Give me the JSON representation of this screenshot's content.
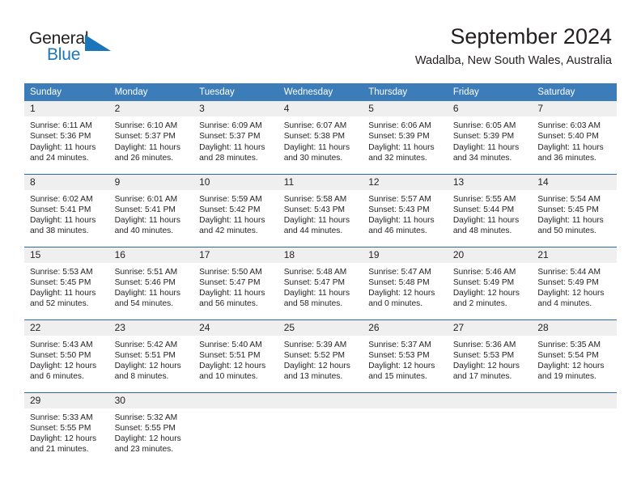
{
  "logo": {
    "word_one": "General",
    "word_two": "Blue",
    "triangle_icon": "triangle-icon"
  },
  "header": {
    "title": "September 2024",
    "subtitle": "Wadalba, New South Wales, Australia"
  },
  "colors": {
    "header_blue": "#3b7cb9",
    "row_divider_blue": "#2b6aa8",
    "daynum_band": "#efefef",
    "logo_blue": "#1b75bb",
    "text": "#231f20"
  },
  "calendar": {
    "weekday_headers": [
      "Sunday",
      "Monday",
      "Tuesday",
      "Wednesday",
      "Thursday",
      "Friday",
      "Saturday"
    ],
    "weeks": [
      [
        {
          "day": "1",
          "sunrise": "Sunrise: 6:11 AM",
          "sunset": "Sunset: 5:36 PM",
          "daylight": "Daylight: 11 hours and 24 minutes."
        },
        {
          "day": "2",
          "sunrise": "Sunrise: 6:10 AM",
          "sunset": "Sunset: 5:37 PM",
          "daylight": "Daylight: 11 hours and 26 minutes."
        },
        {
          "day": "3",
          "sunrise": "Sunrise: 6:09 AM",
          "sunset": "Sunset: 5:37 PM",
          "daylight": "Daylight: 11 hours and 28 minutes."
        },
        {
          "day": "4",
          "sunrise": "Sunrise: 6:07 AM",
          "sunset": "Sunset: 5:38 PM",
          "daylight": "Daylight: 11 hours and 30 minutes."
        },
        {
          "day": "5",
          "sunrise": "Sunrise: 6:06 AM",
          "sunset": "Sunset: 5:39 PM",
          "daylight": "Daylight: 11 hours and 32 minutes."
        },
        {
          "day": "6",
          "sunrise": "Sunrise: 6:05 AM",
          "sunset": "Sunset: 5:39 PM",
          "daylight": "Daylight: 11 hours and 34 minutes."
        },
        {
          "day": "7",
          "sunrise": "Sunrise: 6:03 AM",
          "sunset": "Sunset: 5:40 PM",
          "daylight": "Daylight: 11 hours and 36 minutes."
        }
      ],
      [
        {
          "day": "8",
          "sunrise": "Sunrise: 6:02 AM",
          "sunset": "Sunset: 5:41 PM",
          "daylight": "Daylight: 11 hours and 38 minutes."
        },
        {
          "day": "9",
          "sunrise": "Sunrise: 6:01 AM",
          "sunset": "Sunset: 5:41 PM",
          "daylight": "Daylight: 11 hours and 40 minutes."
        },
        {
          "day": "10",
          "sunrise": "Sunrise: 5:59 AM",
          "sunset": "Sunset: 5:42 PM",
          "daylight": "Daylight: 11 hours and 42 minutes."
        },
        {
          "day": "11",
          "sunrise": "Sunrise: 5:58 AM",
          "sunset": "Sunset: 5:43 PM",
          "daylight": "Daylight: 11 hours and 44 minutes."
        },
        {
          "day": "12",
          "sunrise": "Sunrise: 5:57 AM",
          "sunset": "Sunset: 5:43 PM",
          "daylight": "Daylight: 11 hours and 46 minutes."
        },
        {
          "day": "13",
          "sunrise": "Sunrise: 5:55 AM",
          "sunset": "Sunset: 5:44 PM",
          "daylight": "Daylight: 11 hours and 48 minutes."
        },
        {
          "day": "14",
          "sunrise": "Sunrise: 5:54 AM",
          "sunset": "Sunset: 5:45 PM",
          "daylight": "Daylight: 11 hours and 50 minutes."
        }
      ],
      [
        {
          "day": "15",
          "sunrise": "Sunrise: 5:53 AM",
          "sunset": "Sunset: 5:45 PM",
          "daylight": "Daylight: 11 hours and 52 minutes."
        },
        {
          "day": "16",
          "sunrise": "Sunrise: 5:51 AM",
          "sunset": "Sunset: 5:46 PM",
          "daylight": "Daylight: 11 hours and 54 minutes."
        },
        {
          "day": "17",
          "sunrise": "Sunrise: 5:50 AM",
          "sunset": "Sunset: 5:47 PM",
          "daylight": "Daylight: 11 hours and 56 minutes."
        },
        {
          "day": "18",
          "sunrise": "Sunrise: 5:48 AM",
          "sunset": "Sunset: 5:47 PM",
          "daylight": "Daylight: 11 hours and 58 minutes."
        },
        {
          "day": "19",
          "sunrise": "Sunrise: 5:47 AM",
          "sunset": "Sunset: 5:48 PM",
          "daylight": "Daylight: 12 hours and 0 minutes."
        },
        {
          "day": "20",
          "sunrise": "Sunrise: 5:46 AM",
          "sunset": "Sunset: 5:49 PM",
          "daylight": "Daylight: 12 hours and 2 minutes."
        },
        {
          "day": "21",
          "sunrise": "Sunrise: 5:44 AM",
          "sunset": "Sunset: 5:49 PM",
          "daylight": "Daylight: 12 hours and 4 minutes."
        }
      ],
      [
        {
          "day": "22",
          "sunrise": "Sunrise: 5:43 AM",
          "sunset": "Sunset: 5:50 PM",
          "daylight": "Daylight: 12 hours and 6 minutes."
        },
        {
          "day": "23",
          "sunrise": "Sunrise: 5:42 AM",
          "sunset": "Sunset: 5:51 PM",
          "daylight": "Daylight: 12 hours and 8 minutes."
        },
        {
          "day": "24",
          "sunrise": "Sunrise: 5:40 AM",
          "sunset": "Sunset: 5:51 PM",
          "daylight": "Daylight: 12 hours and 10 minutes."
        },
        {
          "day": "25",
          "sunrise": "Sunrise: 5:39 AM",
          "sunset": "Sunset: 5:52 PM",
          "daylight": "Daylight: 12 hours and 13 minutes."
        },
        {
          "day": "26",
          "sunrise": "Sunrise: 5:37 AM",
          "sunset": "Sunset: 5:53 PM",
          "daylight": "Daylight: 12 hours and 15 minutes."
        },
        {
          "day": "27",
          "sunrise": "Sunrise: 5:36 AM",
          "sunset": "Sunset: 5:53 PM",
          "daylight": "Daylight: 12 hours and 17 minutes."
        },
        {
          "day": "28",
          "sunrise": "Sunrise: 5:35 AM",
          "sunset": "Sunset: 5:54 PM",
          "daylight": "Daylight: 12 hours and 19 minutes."
        }
      ],
      [
        {
          "day": "29",
          "sunrise": "Sunrise: 5:33 AM",
          "sunset": "Sunset: 5:55 PM",
          "daylight": "Daylight: 12 hours and 21 minutes."
        },
        {
          "day": "30",
          "sunrise": "Sunrise: 5:32 AM",
          "sunset": "Sunset: 5:55 PM",
          "daylight": "Daylight: 12 hours and 23 minutes."
        },
        {
          "day": "",
          "sunrise": "",
          "sunset": "",
          "daylight": ""
        },
        {
          "day": "",
          "sunrise": "",
          "sunset": "",
          "daylight": ""
        },
        {
          "day": "",
          "sunrise": "",
          "sunset": "",
          "daylight": ""
        },
        {
          "day": "",
          "sunrise": "",
          "sunset": "",
          "daylight": ""
        },
        {
          "day": "",
          "sunrise": "",
          "sunset": "",
          "daylight": ""
        }
      ]
    ]
  }
}
